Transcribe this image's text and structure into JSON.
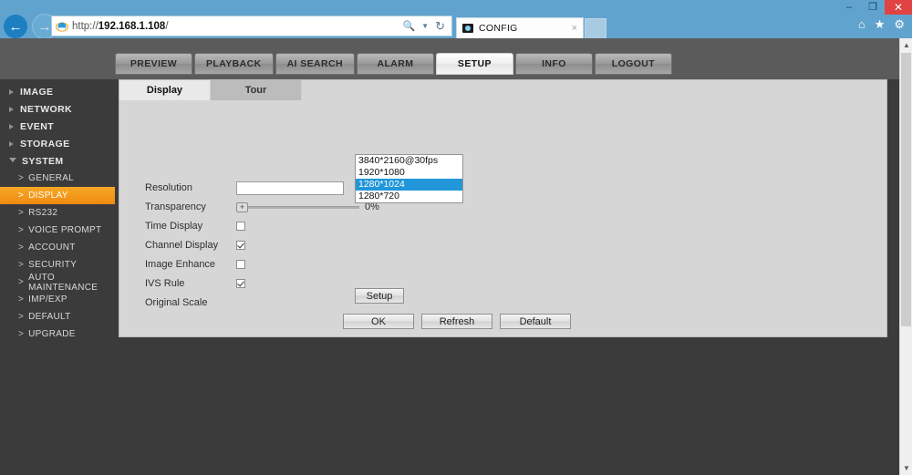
{
  "browser": {
    "url_prefix": "http://",
    "url_host": "192.168.1.108",
    "url_suffix": "/",
    "search_icon": "search-icon",
    "refresh_icon": "refresh-icon",
    "back_icon": "back-arrow-icon",
    "forward_icon": "forward-arrow-icon",
    "tab_title": "CONFIG",
    "tab_close": "×",
    "minimize": "–",
    "restore": "❐",
    "close": "✕",
    "home_icon": "⌂",
    "favorites_icon": "★",
    "settings_icon": "⚙"
  },
  "nav_tabs": [
    {
      "label": "PREVIEW",
      "active": false
    },
    {
      "label": "PLAYBACK",
      "active": false
    },
    {
      "label": "AI SEARCH",
      "active": false
    },
    {
      "label": "ALARM",
      "active": false
    },
    {
      "label": "SETUP",
      "active": true
    },
    {
      "label": "INFO",
      "active": false
    },
    {
      "label": "LOGOUT",
      "active": false
    }
  ],
  "sidebar": {
    "groups": [
      {
        "label": "IMAGE",
        "expanded": false
      },
      {
        "label": "NETWORK",
        "expanded": false
      },
      {
        "label": "EVENT",
        "expanded": false
      },
      {
        "label": "STORAGE",
        "expanded": false
      },
      {
        "label": "SYSTEM",
        "expanded": true
      }
    ],
    "items": [
      {
        "label": "GENERAL",
        "active": false
      },
      {
        "label": "DISPLAY",
        "active": true
      },
      {
        "label": "RS232",
        "active": false
      },
      {
        "label": "VOICE PROMPT",
        "active": false
      },
      {
        "label": "ACCOUNT",
        "active": false
      },
      {
        "label": "SECURITY",
        "active": false
      },
      {
        "label": "AUTO MAINTENANCE",
        "active": false
      },
      {
        "label": "IMP/EXP",
        "active": false
      },
      {
        "label": "DEFAULT",
        "active": false
      },
      {
        "label": "UPGRADE",
        "active": false
      }
    ],
    "accent_color": "#ef8a12",
    "bg_color": "#3b3b3b"
  },
  "subtabs": [
    {
      "label": "Display",
      "active": true
    },
    {
      "label": "Tour",
      "active": false
    }
  ],
  "form": {
    "rows": [
      {
        "label": "Resolution",
        "type": "select"
      },
      {
        "label": "Transparency",
        "type": "slider",
        "value": "0%"
      },
      {
        "label": "Time Display",
        "type": "checkbox",
        "checked": false
      },
      {
        "label": "Channel Display",
        "type": "checkbox",
        "checked": true
      },
      {
        "label": "Image Enhance",
        "type": "checkbox",
        "checked": false
      },
      {
        "label": "IVS Rule",
        "type": "checkbox",
        "checked": true
      },
      {
        "label": "Original Scale",
        "type": "button",
        "button_label": "Setup"
      }
    ],
    "slider_knob": "+",
    "transparency_value": "0%",
    "setup_label": "Setup"
  },
  "buttons": {
    "ok": "OK",
    "refresh": "Refresh",
    "default": "Default"
  },
  "dropdown": {
    "open": true,
    "selected_index": 2,
    "highlight_color": "#2196d9",
    "options": [
      "3840*2160@30fps",
      "1920*1080",
      "1280*1024",
      "1280*720"
    ]
  },
  "scrollbar": {
    "up_arrow": "▲",
    "down_arrow": "▼"
  }
}
